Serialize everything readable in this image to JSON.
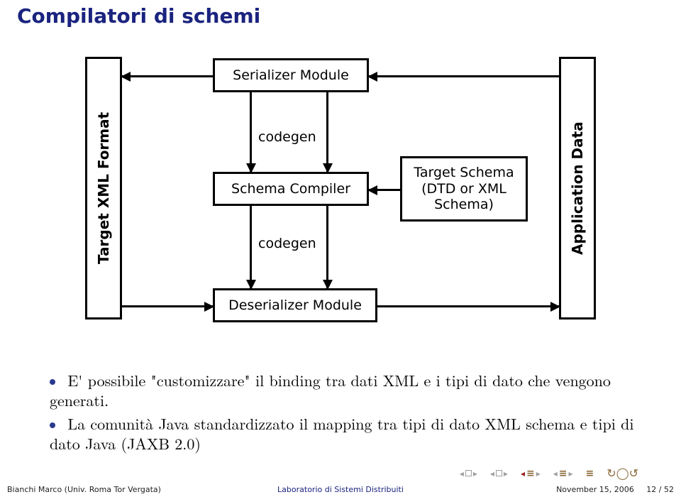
{
  "title": "Compilatori di schemi",
  "diagram": {
    "left_block": "Target XML  Format",
    "right_block": "Application Data",
    "serializer": "Serializer Module",
    "compiler": "Schema Compiler",
    "deserializer": "Deserializer Module",
    "target_schema": "Target Schema (DTD or XML Schema)",
    "codegen_top": "codegen",
    "codegen_bottom": "codegen"
  },
  "bullets": [
    "E' possibile \"customizzare\" il binding tra dati XML e i tipi di dato che vengono generati.",
    "La comunità Java standardizzato il mapping tra tipi di dato XML schema e tipi di dato Java (JAXB 2.0)"
  ],
  "footer": {
    "left": "Bianchi Marco (Univ. Roma Tor Vergata)",
    "center": "Laboratorio di Sistemi Distribuiti",
    "date": "November 15, 2006",
    "page_current": "12",
    "page_total": "52"
  }
}
